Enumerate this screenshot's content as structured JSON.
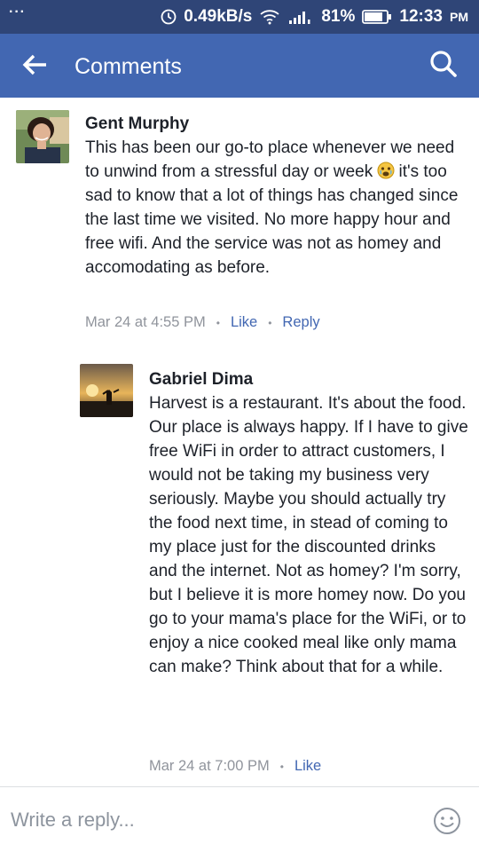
{
  "status_bar": {
    "menu_dots": "···",
    "network_speed": "0.49kB/s",
    "battery_percent": "81%",
    "time": "12:33",
    "ampm": "PM"
  },
  "app_bar": {
    "title": "Comments"
  },
  "comments": [
    {
      "author": "Gent Murphy",
      "text_line1": "This has been our go-to place whenever we need to unwind from a stressful day or week",
      "text_line2": "it's too sad to know that a lot of things has changed since the last time we visited. No more happy hour and free wifi. And the service was not as homey and accomodating as before.",
      "timestamp": "Mar 24 at 4:55 PM",
      "like_label": "Like",
      "reply_label": "Reply"
    },
    {
      "author": "Gabriel Dima",
      "text": "Harvest is a restaurant. It's about the food. Our place is always happy. If I have to give free WiFi in order to attract customers, I would not be taking my business very seriously. Maybe you should actually try the food next time, in stead of coming to my place just for the discounted drinks and the internet. Not as homey? I'm sorry, but I believe it is more homey now. Do you go to your mama's place for the WiFi, or to enjoy a nice cooked meal like only mama can make? Think about that for a while.",
      "timestamp": "Mar 24 at 7:00 PM",
      "like_label": "Like"
    }
  ],
  "reply_bar": {
    "placeholder": "Write a reply..."
  },
  "colors": {
    "status_bar": "#2f4577",
    "app_bar": "#4267b2",
    "link": "#4267b2",
    "meta_text": "#90949c"
  }
}
